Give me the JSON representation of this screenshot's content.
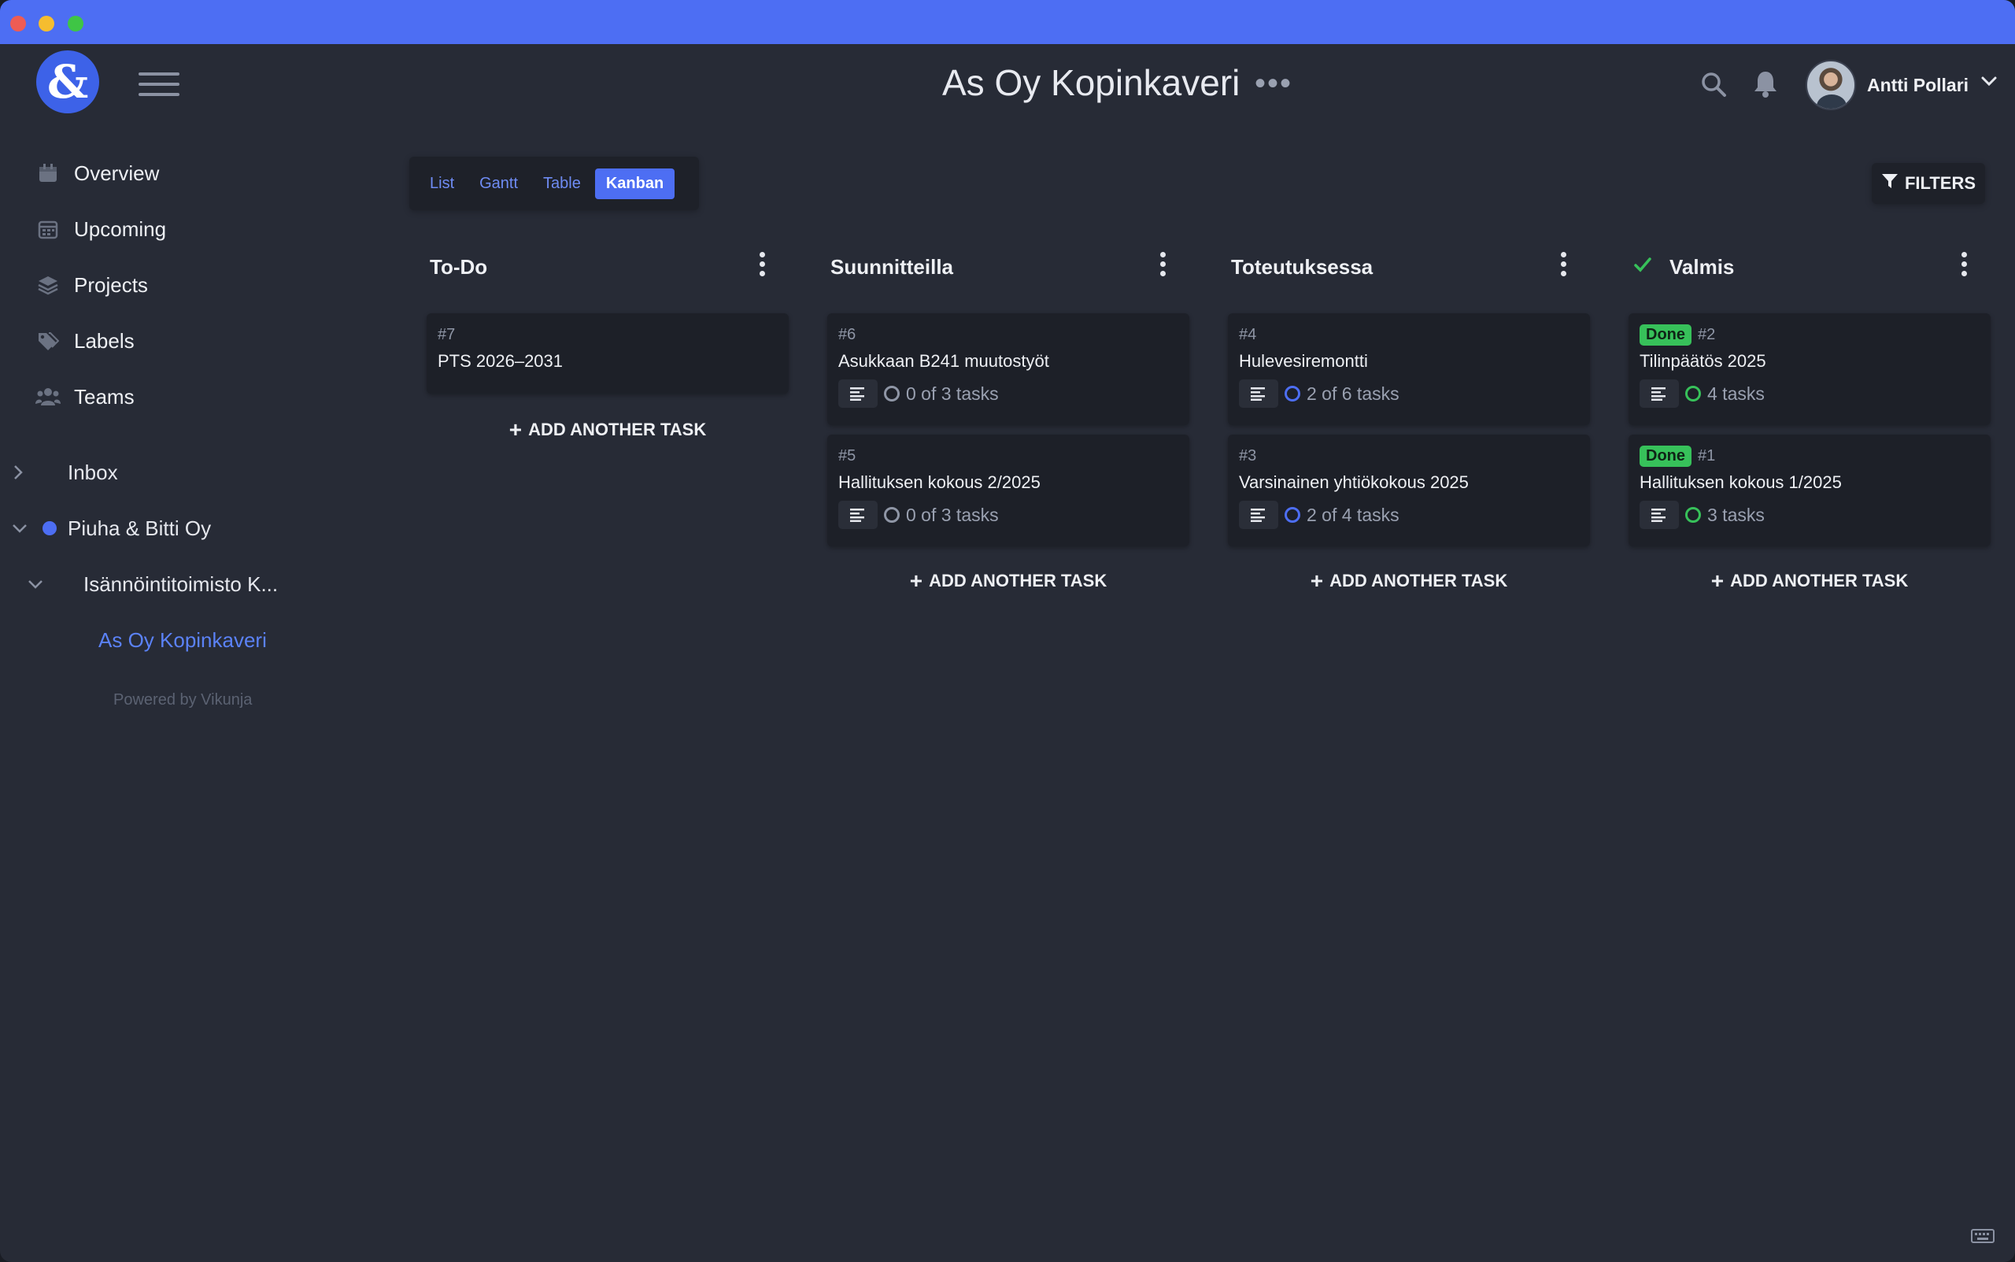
{
  "app": {
    "project_title": "As Oy Kopinkaveri",
    "logo_glyph": "&",
    "accent_color": "#4d6ef3",
    "done_color": "#37c15a"
  },
  "header": {
    "title_menu_glyph": "•••",
    "user_name": "Antti Pollari"
  },
  "sidebar": {
    "nav": [
      {
        "label": "Overview",
        "icon": "calendar-icon"
      },
      {
        "label": "Upcoming",
        "icon": "calendar-grid-icon"
      },
      {
        "label": "Projects",
        "icon": "layers-icon"
      },
      {
        "label": "Labels",
        "icon": "tags-icon"
      },
      {
        "label": "Teams",
        "icon": "users-icon"
      }
    ],
    "tree": {
      "inbox": "Inbox",
      "org": "Piuha & Bitti Oy",
      "parent_project": "Isännöintitoimisto K...",
      "active_project": "As Oy Kopinkaveri"
    },
    "powered_by": "Powered by Vikunja"
  },
  "views": {
    "list": "List",
    "gantt": "Gantt",
    "table": "Table",
    "kanban": "Kanban",
    "active": "Kanban"
  },
  "filters_label": "FILTERS",
  "kanban": {
    "add_task_label": "ADD ANOTHER TASK",
    "buckets": [
      {
        "title": "To-Do",
        "done_bucket": false,
        "cards": [
          {
            "id": "#7",
            "title": "PTS 2026–2031",
            "done": false,
            "progress": ""
          }
        ]
      },
      {
        "title": "Suunnitteilla",
        "done_bucket": false,
        "cards": [
          {
            "id": "#6",
            "title": "Asukkaan B241 muutostyöt",
            "done": false,
            "progress": "0 of 3 tasks"
          },
          {
            "id": "#5",
            "title": "Hallituksen kokous 2/2025",
            "done": false,
            "progress": "0 of 3 tasks"
          }
        ]
      },
      {
        "title": "Toteutuksessa",
        "done_bucket": false,
        "cards": [
          {
            "id": "#4",
            "title": "Hulevesiremontti",
            "done": false,
            "progress": "2 of 6 tasks"
          },
          {
            "id": "#3",
            "title": "Varsinainen yhtiökokous 2025",
            "done": false,
            "progress": "2 of 4 tasks"
          }
        ]
      },
      {
        "title": "Valmis",
        "done_bucket": true,
        "cards": [
          {
            "id": "#2",
            "title": "Tilinpäätös 2025",
            "done": true,
            "done_label": "Done",
            "progress": "4 tasks"
          },
          {
            "id": "#1",
            "title": "Hallituksen kokous 1/2025",
            "done": true,
            "done_label": "Done",
            "progress": "3 tasks"
          }
        ]
      }
    ]
  }
}
